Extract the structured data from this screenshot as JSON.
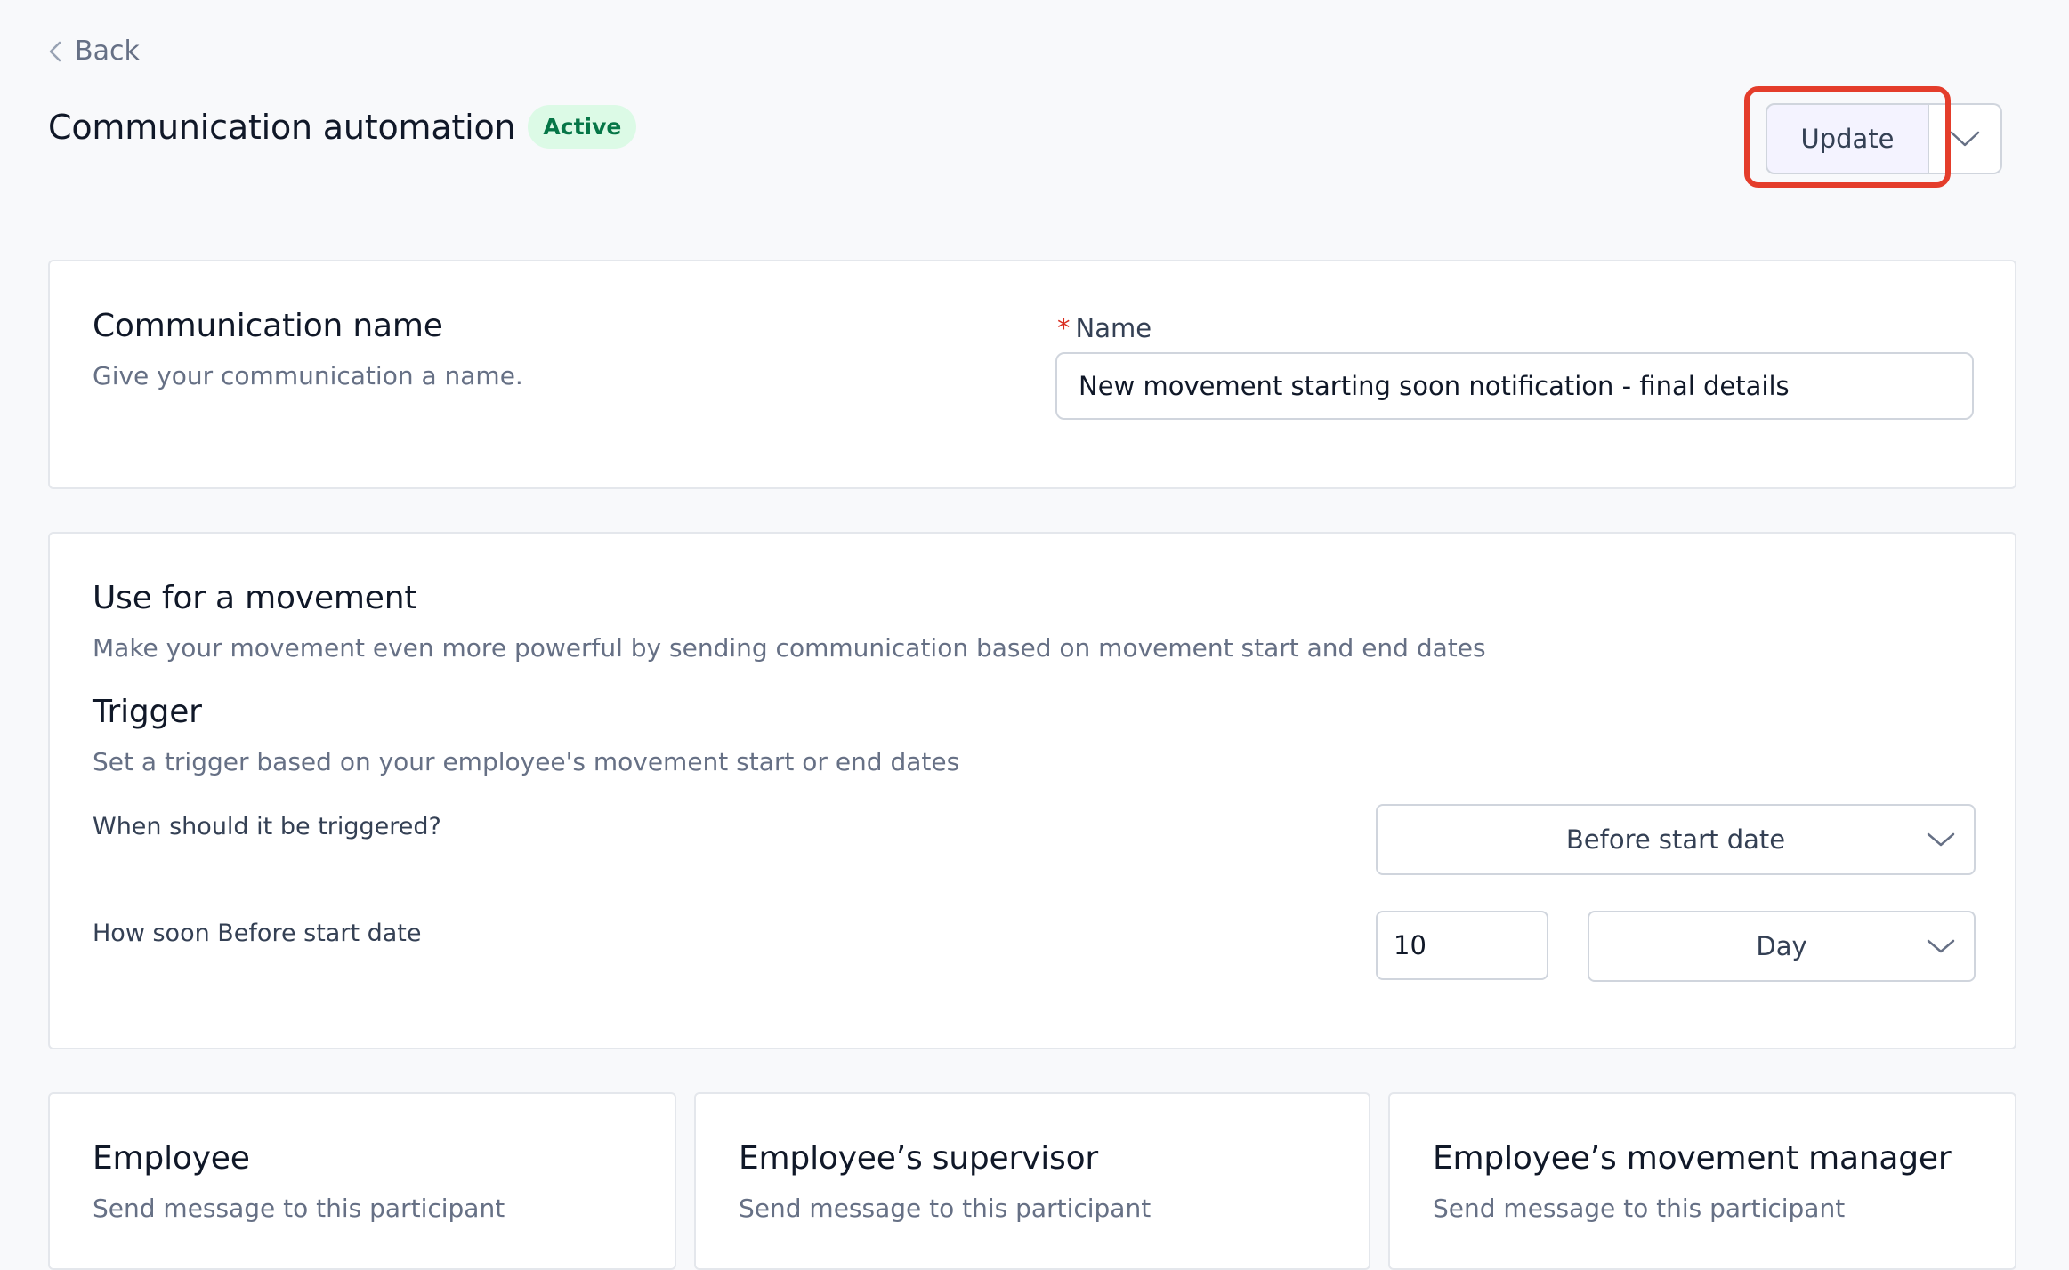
{
  "nav": {
    "back_label": "Back"
  },
  "header": {
    "title": "Communication automation",
    "status": "Active",
    "update_label": "Update"
  },
  "name_section": {
    "heading": "Communication name",
    "description": "Give your communication a name.",
    "required_mark": "*",
    "field_label": "Name",
    "field_value": "New movement starting soon notification - final details"
  },
  "movement_section": {
    "heading": "Use for a movement",
    "description": "Make your movement even more powerful by sending communication based on movement start and end dates",
    "trigger_heading": "Trigger",
    "trigger_description": "Set a trigger based on your employee's movement start or end dates",
    "when_label": "When should it be triggered?",
    "when_value": "Before start date",
    "how_soon_label": "How soon Before start date",
    "how_soon_value": "10",
    "unit_value": "Day"
  },
  "participants": [
    {
      "title": "Employee",
      "description": "Send message to this participant"
    },
    {
      "title": "Employee’s supervisor",
      "description": "Send message to this participant"
    },
    {
      "title": "Employee’s movement manager",
      "description": "Send message to this participant"
    }
  ],
  "icons": {
    "back": "chevron-left-icon",
    "dropdown": "chevron-down-icon"
  },
  "colors": {
    "highlight": "#e43d2b",
    "badge_bg": "#dcfae6",
    "badge_text": "#067647",
    "required": "#d92d20"
  }
}
